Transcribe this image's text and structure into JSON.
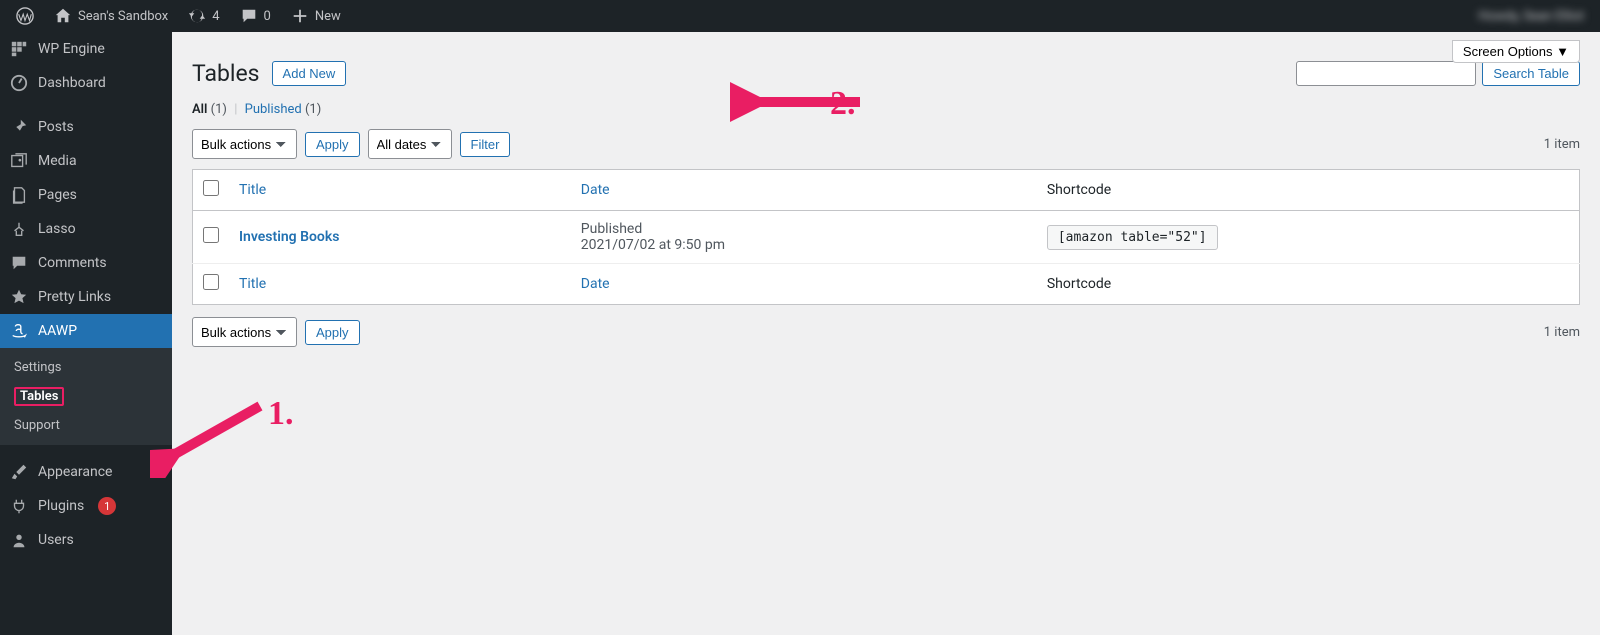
{
  "admin_bar": {
    "site_title": "Sean's Sandbox",
    "updates": "4",
    "comments": "0",
    "new_label": "New",
    "user_greeting": "Howdy, Sean Elliot"
  },
  "sidebar": {
    "items": [
      {
        "label": "WP Engine"
      },
      {
        "label": "Dashboard"
      },
      {
        "label": "Posts"
      },
      {
        "label": "Media"
      },
      {
        "label": "Pages"
      },
      {
        "label": "Lasso"
      },
      {
        "label": "Comments"
      },
      {
        "label": "Pretty Links"
      },
      {
        "label": "AAWP"
      },
      {
        "label": "Appearance"
      },
      {
        "label": "Plugins"
      },
      {
        "label": "Users"
      }
    ],
    "submenu": [
      {
        "label": "Settings"
      },
      {
        "label": "Tables"
      },
      {
        "label": "Support"
      }
    ],
    "plugins_badge": "1"
  },
  "page": {
    "screen_options": "Screen Options",
    "heading": "Tables",
    "add_new": "Add New",
    "filters": {
      "all_label": "All",
      "all_count": "(1)",
      "sep": "|",
      "published_label": "Published",
      "published_count": "(1)"
    },
    "search_btn": "Search Table",
    "bulk_actions": "Bulk actions",
    "apply": "Apply",
    "all_dates": "All dates",
    "filter": "Filter",
    "item_count": "1 item",
    "columns": {
      "title": "Title",
      "date": "Date",
      "shortcode": "Shortcode"
    },
    "rows": [
      {
        "title": "Investing Books",
        "status": "Published",
        "date_line": "2021/07/02 at 9:50 pm",
        "shortcode": "[amazon table=\"52\"]"
      }
    ]
  },
  "annotations": {
    "one": "1.",
    "two": "2."
  }
}
